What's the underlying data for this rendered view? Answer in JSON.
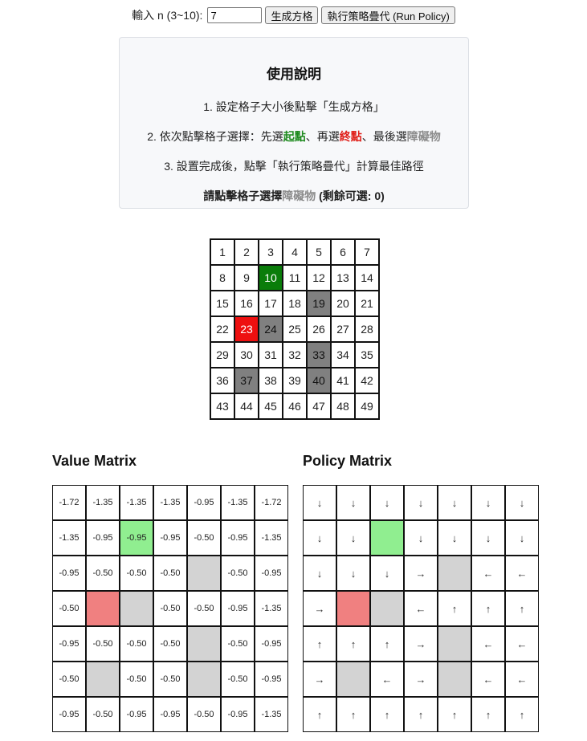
{
  "controls": {
    "label": "輸入 n (3~10):",
    "n_value": "7",
    "generate_label": "生成方格",
    "run_label": "執行策略疊代 (Run Policy)"
  },
  "instructions": {
    "title": "使用說明",
    "step1": "1. 設定格子大小後點擊「生成方格」",
    "step2_prefix": "2. 依次點擊格子選擇：先選",
    "step2_start": "起點",
    "step2_mid": "、再選",
    "step2_end": "終點",
    "step2_mid2": "、最後選",
    "step2_obstacle": "障礙物",
    "step3": "3. 設置完成後，點擊「執行策略疊代」計算最佳路徑",
    "status_prefix": "請點擊格子選擇",
    "status_obstacle": "障礙物",
    "status_suffix": " (剩餘可選: 0)"
  },
  "colors": {
    "start": "#0a7d0a",
    "end": "#ee1010",
    "obstacle": "#808080",
    "matrix_start": "#90ee90",
    "matrix_end": "#f08080",
    "matrix_obstacle": "#d3d3d3"
  },
  "grid": {
    "n": 7,
    "start": 10,
    "end": 23,
    "obstacles": [
      19,
      24,
      33,
      37,
      40
    ]
  },
  "value_matrix": {
    "title": "Value Matrix",
    "rows": [
      [
        "-1.72",
        "-1.35",
        "-1.35",
        "-1.35",
        "-0.95",
        "-1.35",
        "-1.72"
      ],
      [
        "-1.35",
        "-0.95",
        "-0.95",
        "-0.95",
        "-0.50",
        "-0.95",
        "-1.35"
      ],
      [
        "-0.95",
        "-0.50",
        "-0.50",
        "-0.50",
        "",
        "-0.50",
        "-0.95"
      ],
      [
        "-0.50",
        "",
        "",
        "-0.50",
        "-0.50",
        "-0.95",
        "-1.35"
      ],
      [
        "-0.95",
        "-0.50",
        "-0.50",
        "-0.50",
        "",
        "-0.50",
        "-0.95"
      ],
      [
        "-0.50",
        "",
        "-0.50",
        "-0.50",
        "",
        "-0.50",
        "-0.95"
      ],
      [
        "-0.95",
        "-0.50",
        "-0.95",
        "-0.95",
        "-0.50",
        "-0.95",
        "-1.35"
      ]
    ]
  },
  "policy_matrix": {
    "title": "Policy Matrix",
    "rows": [
      [
        "↓",
        "↓",
        "↓",
        "↓",
        "↓",
        "↓",
        "↓"
      ],
      [
        "↓",
        "↓",
        "",
        "↓",
        "↓",
        "↓",
        "↓"
      ],
      [
        "↓",
        "↓",
        "↓",
        "→",
        "",
        "←",
        "←"
      ],
      [
        "→",
        "",
        "",
        "←",
        "↑",
        "↑",
        "↑"
      ],
      [
        "↑",
        "↑",
        "↑",
        "→",
        "",
        "←",
        "←"
      ],
      [
        "→",
        "",
        "←",
        "→",
        "",
        "←",
        "←"
      ],
      [
        "↑",
        "↑",
        "↑",
        "↑",
        "↑",
        "↑",
        "↑"
      ]
    ]
  }
}
